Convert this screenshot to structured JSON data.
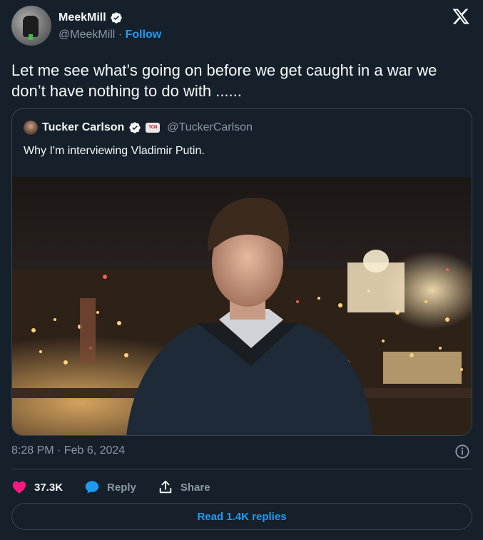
{
  "author": {
    "display_name": "MeekMill",
    "handle": "@MeekMill",
    "separator": "·",
    "follow_label": "Follow"
  },
  "tweet": {
    "text": "Let me see what’s going on before we get caught in a war we don’t have nothing to do with ......",
    "timestamp": "8:28 PM · Feb 6, 2024"
  },
  "quoted": {
    "display_name": "Tucker Carlson",
    "badge_text": "TCN",
    "handle": "@TuckerCarlson",
    "text": "Why I'm interviewing Vladimir Putin."
  },
  "actions": {
    "likes": "37.3K",
    "reply_label": "Reply",
    "share_label": "Share"
  },
  "read_replies_label": "Read 1.4K replies",
  "colors": {
    "background": "#15202b",
    "accent": "#1d9bf0",
    "like": "#f91880",
    "muted": "#8b98a5",
    "border": "#38444d"
  },
  "icons": [
    "verified-badge-icon",
    "x-logo-icon",
    "heart-icon",
    "reply-bubble-icon",
    "share-icon",
    "info-icon"
  ]
}
